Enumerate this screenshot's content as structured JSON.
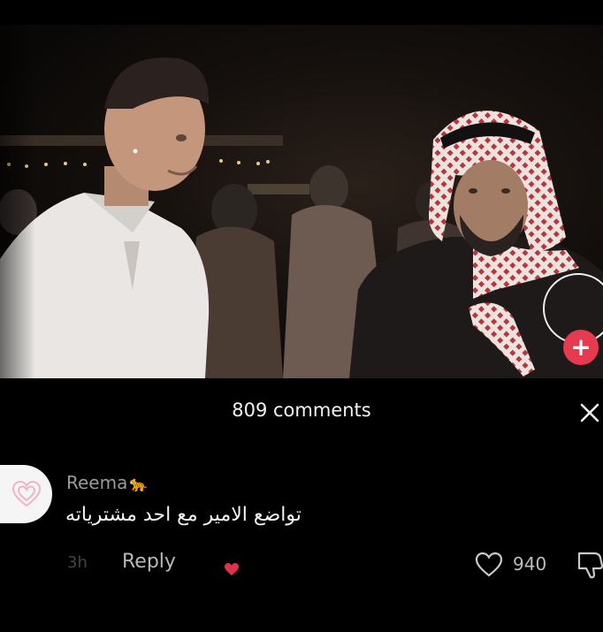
{
  "video": {
    "follow_symbol": "+"
  },
  "comments_sheet": {
    "title": "809 comments",
    "close_icon": "close-icon",
    "comment": {
      "username": "Reema",
      "username_emoji": "🐆",
      "text": "تواضع الامير مع احد مشترياته",
      "time": "3h",
      "reply_label": "Reply",
      "like_count": "940",
      "avatar_icon": "heart-avatar-icon",
      "creator_like_icon": "heart-icon"
    }
  },
  "colors": {
    "background": "#000000",
    "accent_red": "#e83a4f",
    "text_primary": "#f2f2f2",
    "text_secondary": "#9a9a9a"
  }
}
